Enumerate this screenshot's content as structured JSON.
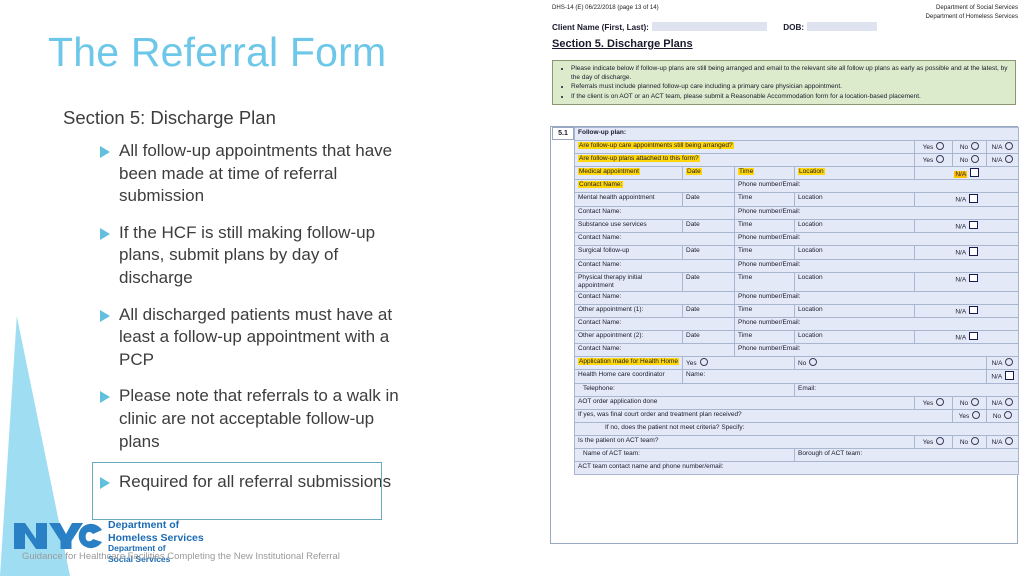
{
  "slide": {
    "title": "The Referral Form",
    "subtitle": "Section 5: Discharge Plan",
    "bullets": [
      "All follow-up appointments that have been made at time of referral submission",
      "If the HCF is still making follow-up plans, submit plans by day of discharge",
      "All discharged patients must have at least a follow-up appointment with a PCP",
      "Please note that referrals to a walk in clinic are not acceptable follow-up plans",
      "Required for all referral submissions"
    ],
    "footer_note": "Guidance for Healthcare Facilities Completing the New Institutional Referral",
    "logo": {
      "mark": "NYC",
      "dept_line1": "Department of",
      "dept_line2": "Homeless Services",
      "dept2_line1": "Department of",
      "dept2_line2": "Social Services"
    },
    "colors": {
      "title": "#6CC7E8",
      "bullet_marker": "#62C0DE",
      "wedge": "#8ED8F0",
      "box_border": "#6BA9BE",
      "logo_blue": "#1B6CB5"
    }
  },
  "form": {
    "doc_meta": "DHS-14 (E) 06/22/2018 (page 13 of 14)",
    "dept_line1": "Department of Social Services",
    "dept_line2": "Department of Homeless Services",
    "client_label": "Client Name (First, Last):",
    "dob_label": "DOB:",
    "section_title": "Section 5. Discharge Plans",
    "instructions": [
      "Please indicate below if follow-up plans are still being arranged and email to the relevant site all follow up plans as early as possible and at the latest, by the day of discharge.",
      "Referrals must include planned follow-up care including a primary care physician appointment.",
      "If the client is on AOT or an ACT team, please submit a Reasonable Accommodation form for a location-based placement."
    ],
    "sub_number": "5.1",
    "sub_header": "Follow-up plan:",
    "q1": "Are follow-up care appointments still being arranged?",
    "q2": "Are follow-up plans attached to this form?",
    "yes": "Yes",
    "no": "No",
    "na": "N/A",
    "col_date": "Date",
    "col_time": "Time",
    "col_location": "Location",
    "contact_name": "Contact Name:",
    "phone_email": "Phone number/Email:",
    "appointments": [
      "Medical appointment",
      "Mental health appointment",
      "Substance use services",
      "Surgical follow-up",
      "Physical therapy initial appointment",
      "Other appointment (1):",
      "Other appointment (2):"
    ],
    "health_home": "Application made for Health Home",
    "hh_coordinator": "Health Home care coordinator",
    "name_label": "Name:",
    "telephone_label": "Telephone:",
    "email_label": "Email:",
    "aot_order": "AOT order application done",
    "aot_followup": "If yes, was final court order and treatment plan received?",
    "aot_criteria": "If no, does the patient not meet criteria? Specify:",
    "act_question": "Is the patient on ACT team?",
    "act_name": "Name of ACT team:",
    "act_borough": "Borough of ACT team:",
    "act_contact": "ACT team contact name and phone number/email:",
    "highlight_color": "#FFD60A"
  }
}
